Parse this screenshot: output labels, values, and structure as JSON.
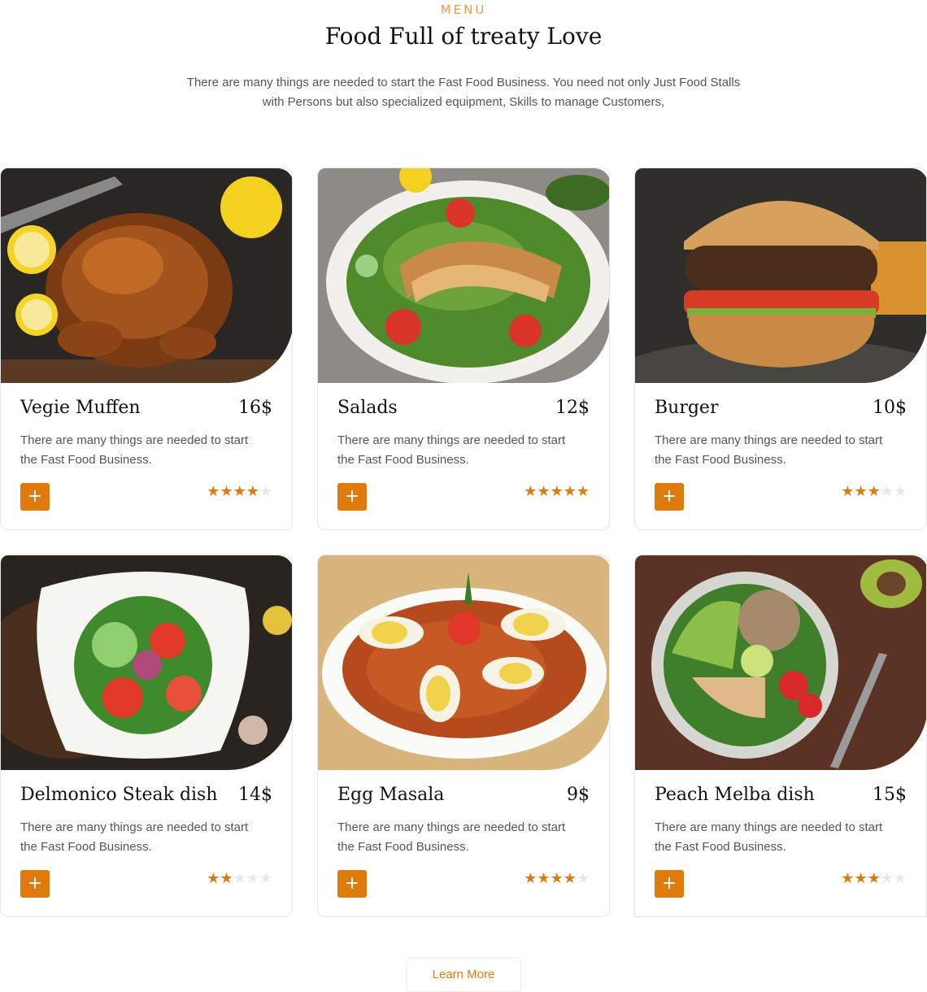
{
  "section": {
    "eyebrow": "MENU",
    "title": "Food Full of treaty Love",
    "intro_line1": "There are many things are needed to start the Fast Food Business. You need not only Just Food Stalls",
    "intro_line2": "with Persons but also specialized equipment, Skills to manage Customers,"
  },
  "colors": {
    "accent": "#de7b0c",
    "eyebrow": "#e59a4a",
    "star_off": "#e8e8e8"
  },
  "icons": {
    "add": "plus-icon",
    "star": "star-icon"
  },
  "add_label": "+",
  "items": [
    {
      "name": "Vegie Muffen",
      "price": "16$",
      "desc_line1": "There are many things are needed to start",
      "desc_line2": "the Fast Food Business.",
      "rating": 4,
      "max_rating": 5,
      "image": "roast-chicken"
    },
    {
      "name": "Salads",
      "price": "12$",
      "desc_line1": "There are many things are needed to start",
      "desc_line2": "the Fast Food Business.",
      "rating": 5,
      "max_rating": 5,
      "image": "chicken-salad"
    },
    {
      "name": "Burger",
      "price": "10$",
      "desc_line1": "There are many things are needed to start",
      "desc_line2": "the Fast Food Business.",
      "rating": 3,
      "max_rating": 5,
      "image": "burger"
    },
    {
      "name": "Delmonico Steak dish",
      "price": "14$",
      "desc_line1": "There are many things are needed to start",
      "desc_line2": "the Fast Food Business.",
      "rating": 2,
      "max_rating": 5,
      "image": "vegetable-salad"
    },
    {
      "name": "Egg Masala",
      "price": "9$",
      "desc_line1": "There are many things are needed to start",
      "desc_line2": "the Fast Food Business.",
      "rating": 4,
      "max_rating": 5,
      "image": "egg-masala"
    },
    {
      "name": "Peach Melba dish",
      "price": "15$",
      "desc_line1": "There are many things are needed to start",
      "desc_line2": "the Fast Food Business.",
      "rating": 3,
      "max_rating": 5,
      "image": "quinoa-bowl"
    }
  ],
  "learn_more": "Learn More"
}
